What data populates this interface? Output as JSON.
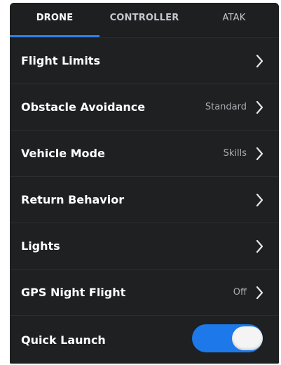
{
  "tabs": [
    {
      "label": "DRONE",
      "active": true
    },
    {
      "label": "CONTROLLER",
      "active": false
    },
    {
      "label": "ATAK",
      "active": false
    }
  ],
  "settings": [
    {
      "label": "Flight Limits",
      "value": ""
    },
    {
      "label": "Obstacle Avoidance",
      "value": "Standard"
    },
    {
      "label": "Vehicle Mode",
      "value": "Skills"
    },
    {
      "label": "Return Behavior",
      "value": ""
    },
    {
      "label": "Lights",
      "value": ""
    },
    {
      "label": "GPS Night Flight",
      "value": "Off"
    }
  ],
  "quick_launch": {
    "label": "Quick Launch",
    "enabled": true
  },
  "colors": {
    "accent": "#1d78ea",
    "background": "#1a1b1d",
    "row": "#1f2022",
    "text": "#ffffff",
    "muted": "#a9acb1"
  },
  "icons": {
    "row_chevron": "chevron-right-icon",
    "toggle": "toggle-switch-on"
  }
}
